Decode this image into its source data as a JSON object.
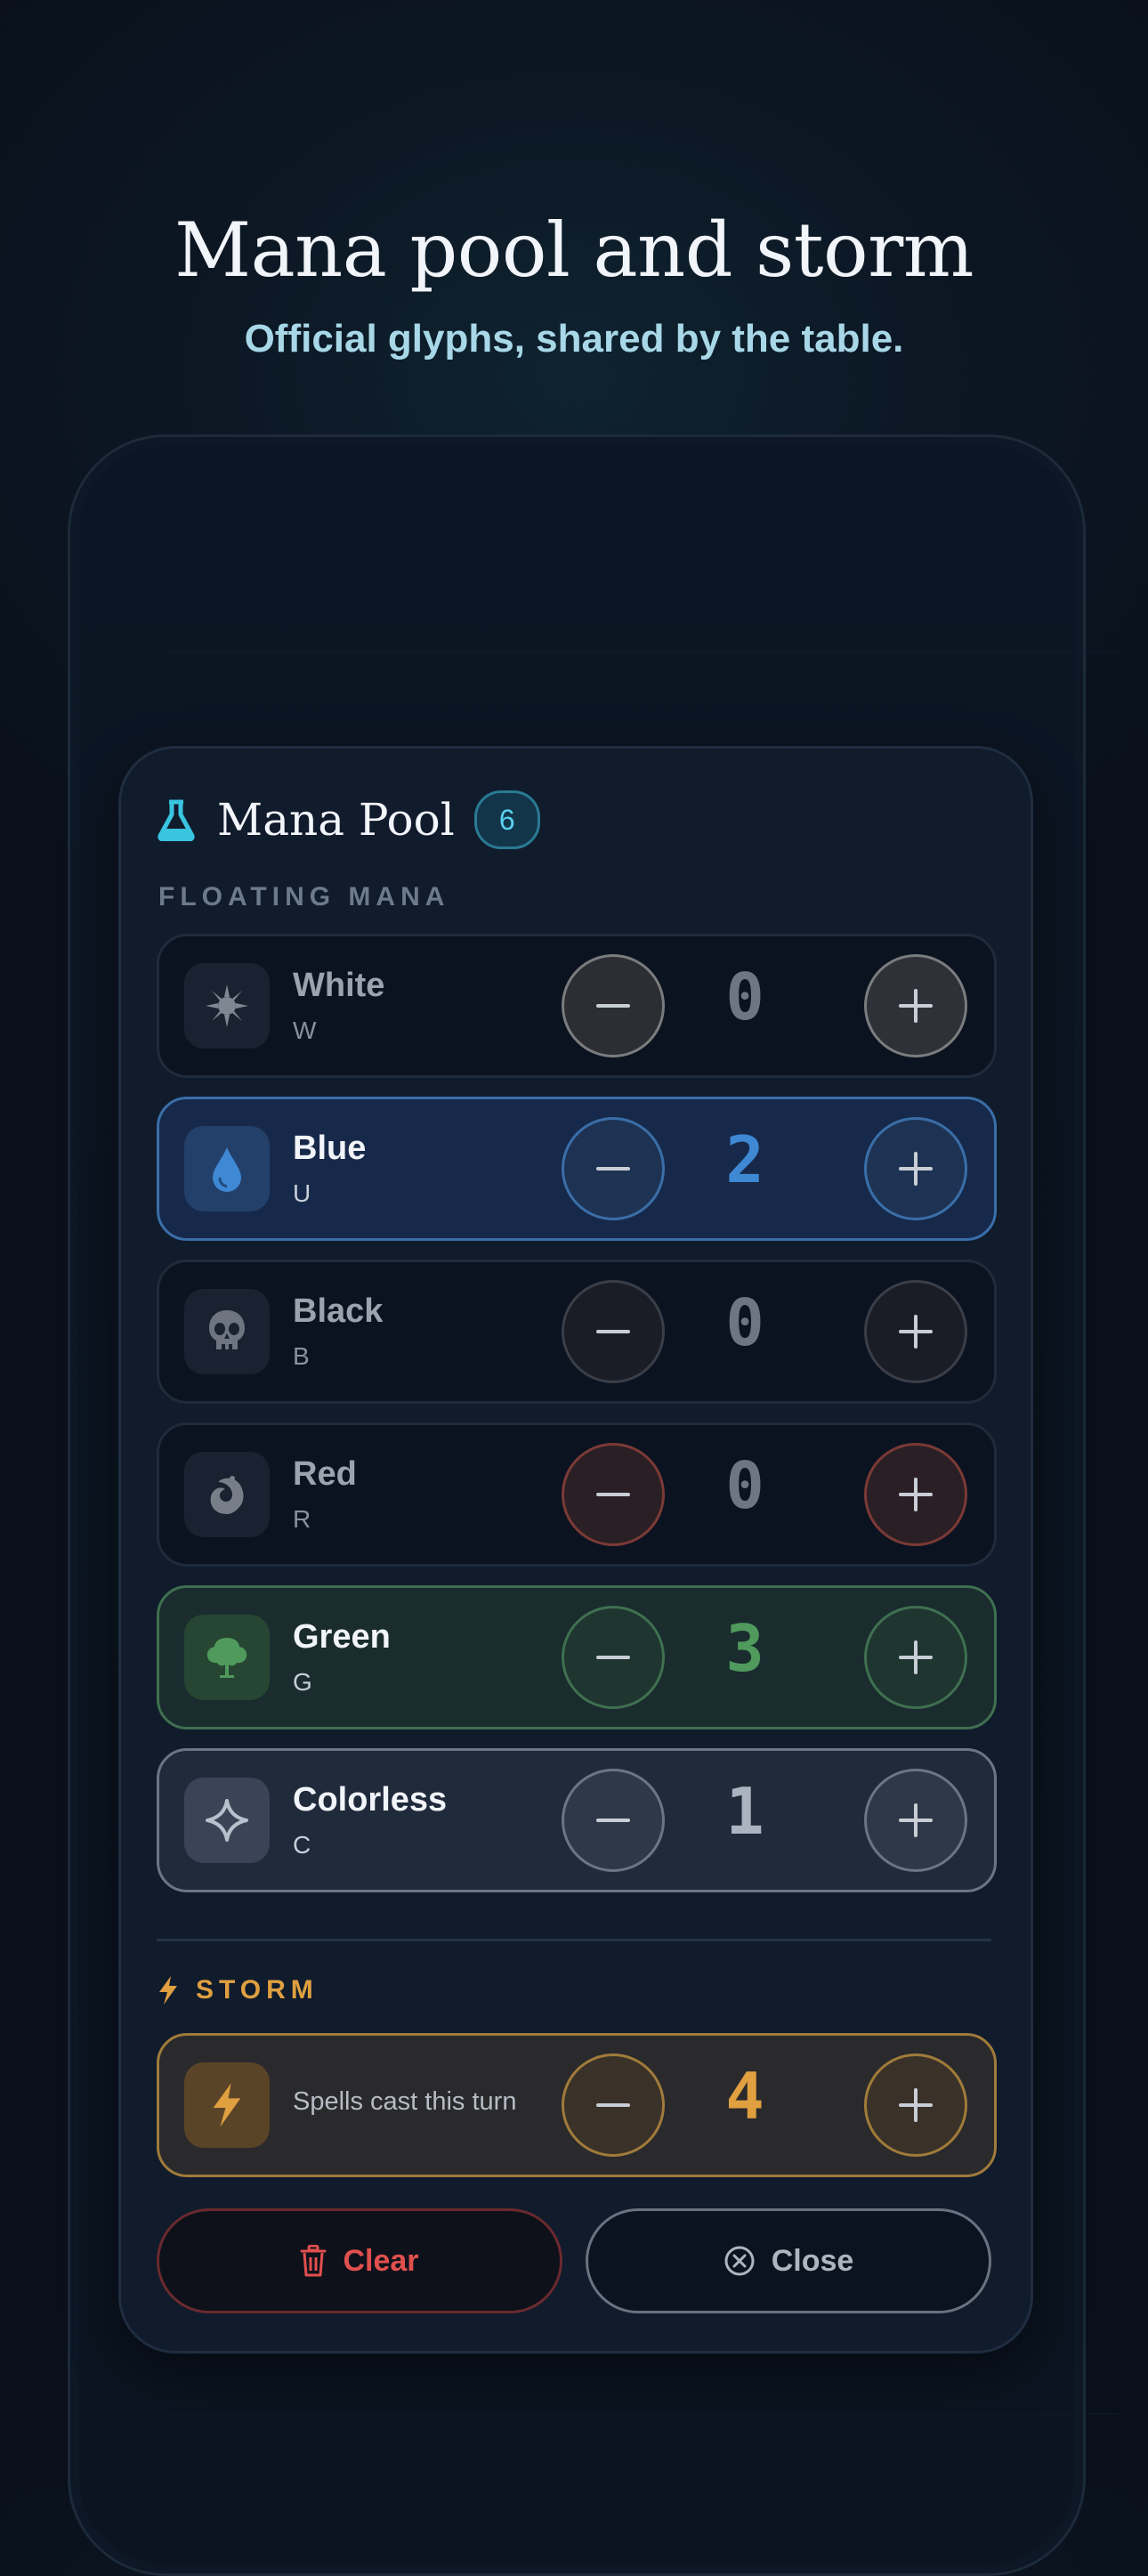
{
  "hero": {
    "title": "Mana pool and storm",
    "subtitle": "Official glyphs, shared by the table."
  },
  "sheet": {
    "title": "Mana Pool",
    "total_badge": "6",
    "floating_label": "FLOATING MANA",
    "mana": [
      {
        "name": "White",
        "code": "W",
        "value": "0",
        "icon": "sun-glyph-icon",
        "color": "#9aa3ae"
      },
      {
        "name": "Blue",
        "code": "U",
        "value": "2",
        "icon": "water-drop-icon",
        "color": "#3f88d4"
      },
      {
        "name": "Black",
        "code": "B",
        "value": "0",
        "icon": "skull-icon",
        "color": "#9aa3ae"
      },
      {
        "name": "Red",
        "code": "R",
        "value": "0",
        "icon": "fire-swirl-icon",
        "color": "#9aa3ae"
      },
      {
        "name": "Green",
        "code": "G",
        "value": "3",
        "icon": "tree-icon",
        "color": "#4f9a5c"
      },
      {
        "name": "Colorless",
        "code": "C",
        "value": "1",
        "icon": "diamond-sparkle-icon",
        "color": "#aab3bf"
      }
    ],
    "storm": {
      "label": "STORM",
      "text": "Spells cast this turn",
      "value": "4",
      "color": "#e0a040"
    },
    "actions": {
      "clear": "Clear",
      "close": "Close"
    }
  }
}
